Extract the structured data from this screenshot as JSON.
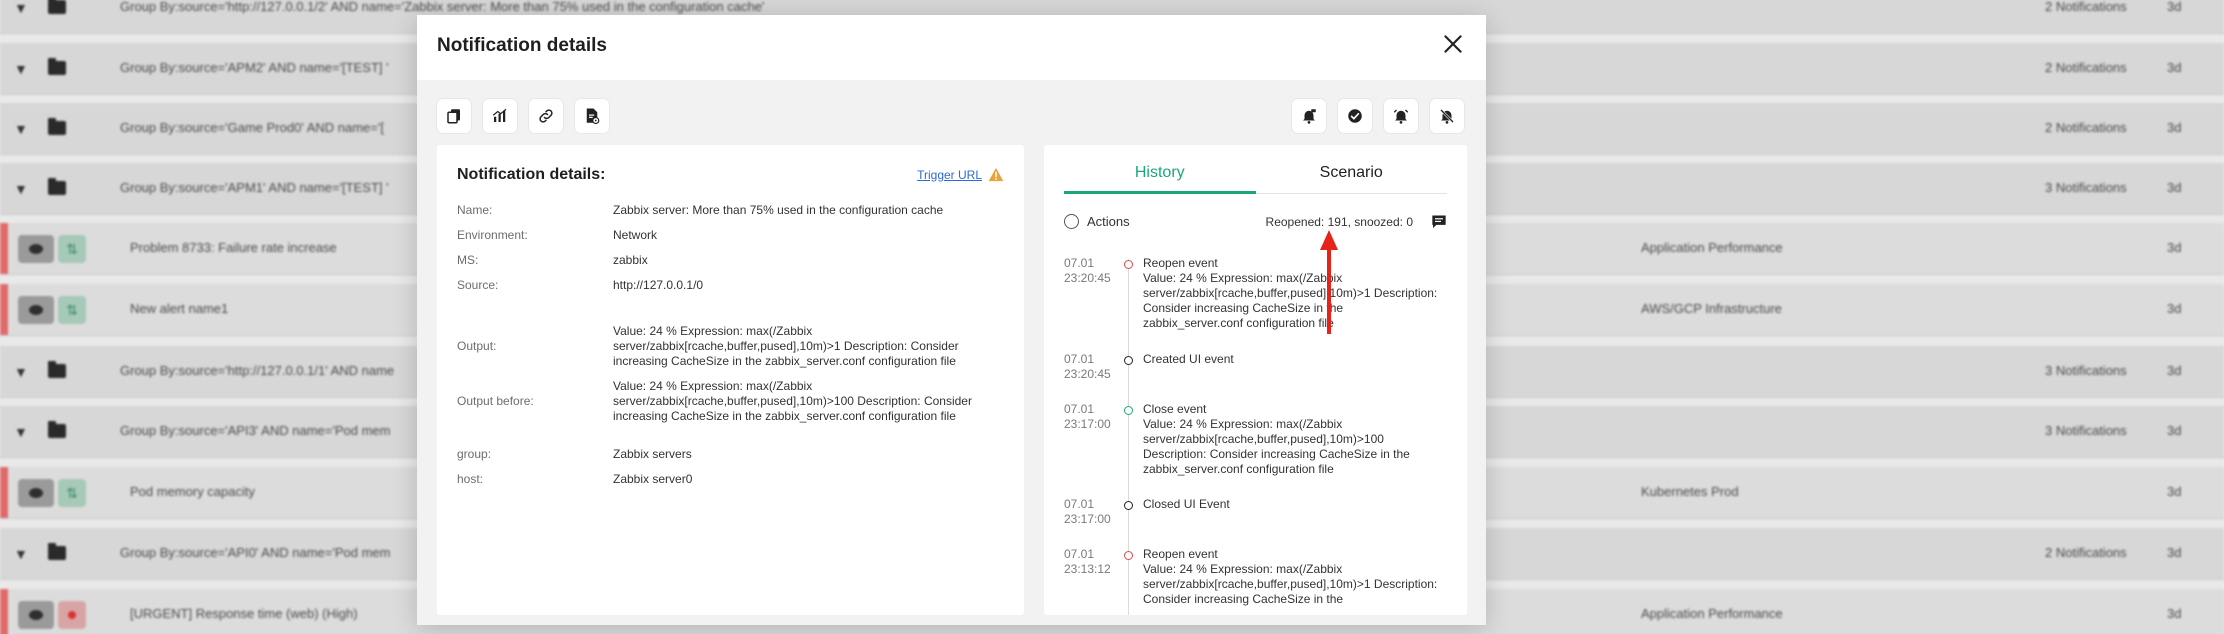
{
  "background": {
    "rows": [
      {
        "type": "group",
        "text": "Group By:source='http://127.0.0.1/2' AND name='Zabbix server: More than 75% used in the configuration cache'",
        "count": "2 Notifications",
        "age": "3d"
      },
      {
        "type": "group",
        "text": "Group By:source='APM2' AND name='[TEST] '",
        "count": "2 Notifications",
        "age": "3d"
      },
      {
        "type": "group",
        "text": "Group By:source='Game Prod0' AND name='[",
        "count": "2 Notifications",
        "age": "3d"
      },
      {
        "type": "group",
        "text": "Group By:source='APM1' AND name='[TEST] '",
        "count": "3 Notifications",
        "age": "3d"
      },
      {
        "type": "alert",
        "text": "Problem 8733: Failure rate increase",
        "category": "Application Performance",
        "age": "3d"
      },
      {
        "type": "alert",
        "text": "New alert name1",
        "category": "AWS/GCP Infrastructure",
        "age": "3d"
      },
      {
        "type": "group",
        "text": "Group By:source='http://127.0.0.1/1' AND name",
        "count": "3 Notifications",
        "age": "3d"
      },
      {
        "type": "group",
        "text": "Group By:source='API3' AND name='Pod mem",
        "count": "3 Notifications",
        "age": "3d"
      },
      {
        "type": "alert",
        "text": "Pod memory capacity",
        "category": "Kubernetes Prod",
        "age": "3d"
      },
      {
        "type": "group",
        "text": "Group By:source='API0' AND name='Pod mem",
        "count": "2 Notifications",
        "age": "3d"
      },
      {
        "type": "alert",
        "text": "[URGENT] Response time (web) (High)",
        "category": "Application Performance",
        "age": "3d"
      }
    ]
  },
  "dialog": {
    "title": "Notification details",
    "details": {
      "title": "Notification details:",
      "trigger_url": "Trigger URL",
      "fields": [
        {
          "label": "Name:",
          "value": "Zabbix server: More than 75% used in the configuration cache"
        },
        {
          "label": "Environment:",
          "value": "Network"
        },
        {
          "label": "MS:",
          "value": "zabbix"
        },
        {
          "label": "Source:",
          "value": "http://127.0.0.1/0"
        },
        {
          "label": "Output:",
          "value": "Value: 24 % Expression: max(/Zabbix server/zabbix[rcache,buffer,pused],10m)>1 Description: Consider increasing CacheSize in the zabbix_server.conf configuration file"
        },
        {
          "label": "Output before:",
          "value": "Value: 24 % Expression: max(/Zabbix server/zabbix[rcache,buffer,pused],10m)>100 Description: Consider increasing CacheSize in the zabbix_server.conf configuration file"
        },
        {
          "label": "group:",
          "value": "Zabbix servers"
        },
        {
          "label": "host:",
          "value": "Zabbix server0"
        }
      ]
    },
    "history": {
      "tabs": [
        "History",
        "Scenario"
      ],
      "actions_label": "Actions",
      "reopened_text": "Reopened: 191, snoozed: 0",
      "events": [
        {
          "date": "07.01 23:20:45",
          "title": "Reopen event",
          "status": "red",
          "desc": "Value: 24 % Expression: max(/Zabbix server/zabbix[rcache,buffer,pused],10m)>1 Description: Consider increasing CacheSize in the zabbix_server.conf configuration file"
        },
        {
          "date": "07.01 23:20:45",
          "title": "Created UI event",
          "status": "dark",
          "desc": ""
        },
        {
          "date": "07.01 23:17:00",
          "title": "Close event",
          "status": "green",
          "desc": "Value: 24 % Expression: max(/Zabbix server/zabbix[rcache,buffer,pused],10m)>100 Description: Consider increasing CacheSize in the zabbix_server.conf configuration file"
        },
        {
          "date": "07.01 23:17:00",
          "title": "Closed UI Event",
          "status": "dark",
          "desc": ""
        },
        {
          "date": "07.01 23:13:12",
          "title": "Reopen event",
          "status": "red",
          "desc": "Value: 24 % Expression: max(/Zabbix server/zabbix[rcache,buffer,pused],10m)>1 Description: Consider increasing CacheSize in the"
        }
      ]
    }
  },
  "colors": {
    "accent": "#1aa87a",
    "link": "#2e6bd8",
    "alert": "#e04848",
    "warning": "#e8a33b"
  },
  "icons": {
    "toolbar_left": [
      "copy-icon",
      "chart-icon",
      "link-icon",
      "document-settings-icon"
    ],
    "toolbar_right": [
      "bell-comment-icon",
      "check-circle-icon",
      "bell-icon",
      "bell-off-icon"
    ]
  }
}
